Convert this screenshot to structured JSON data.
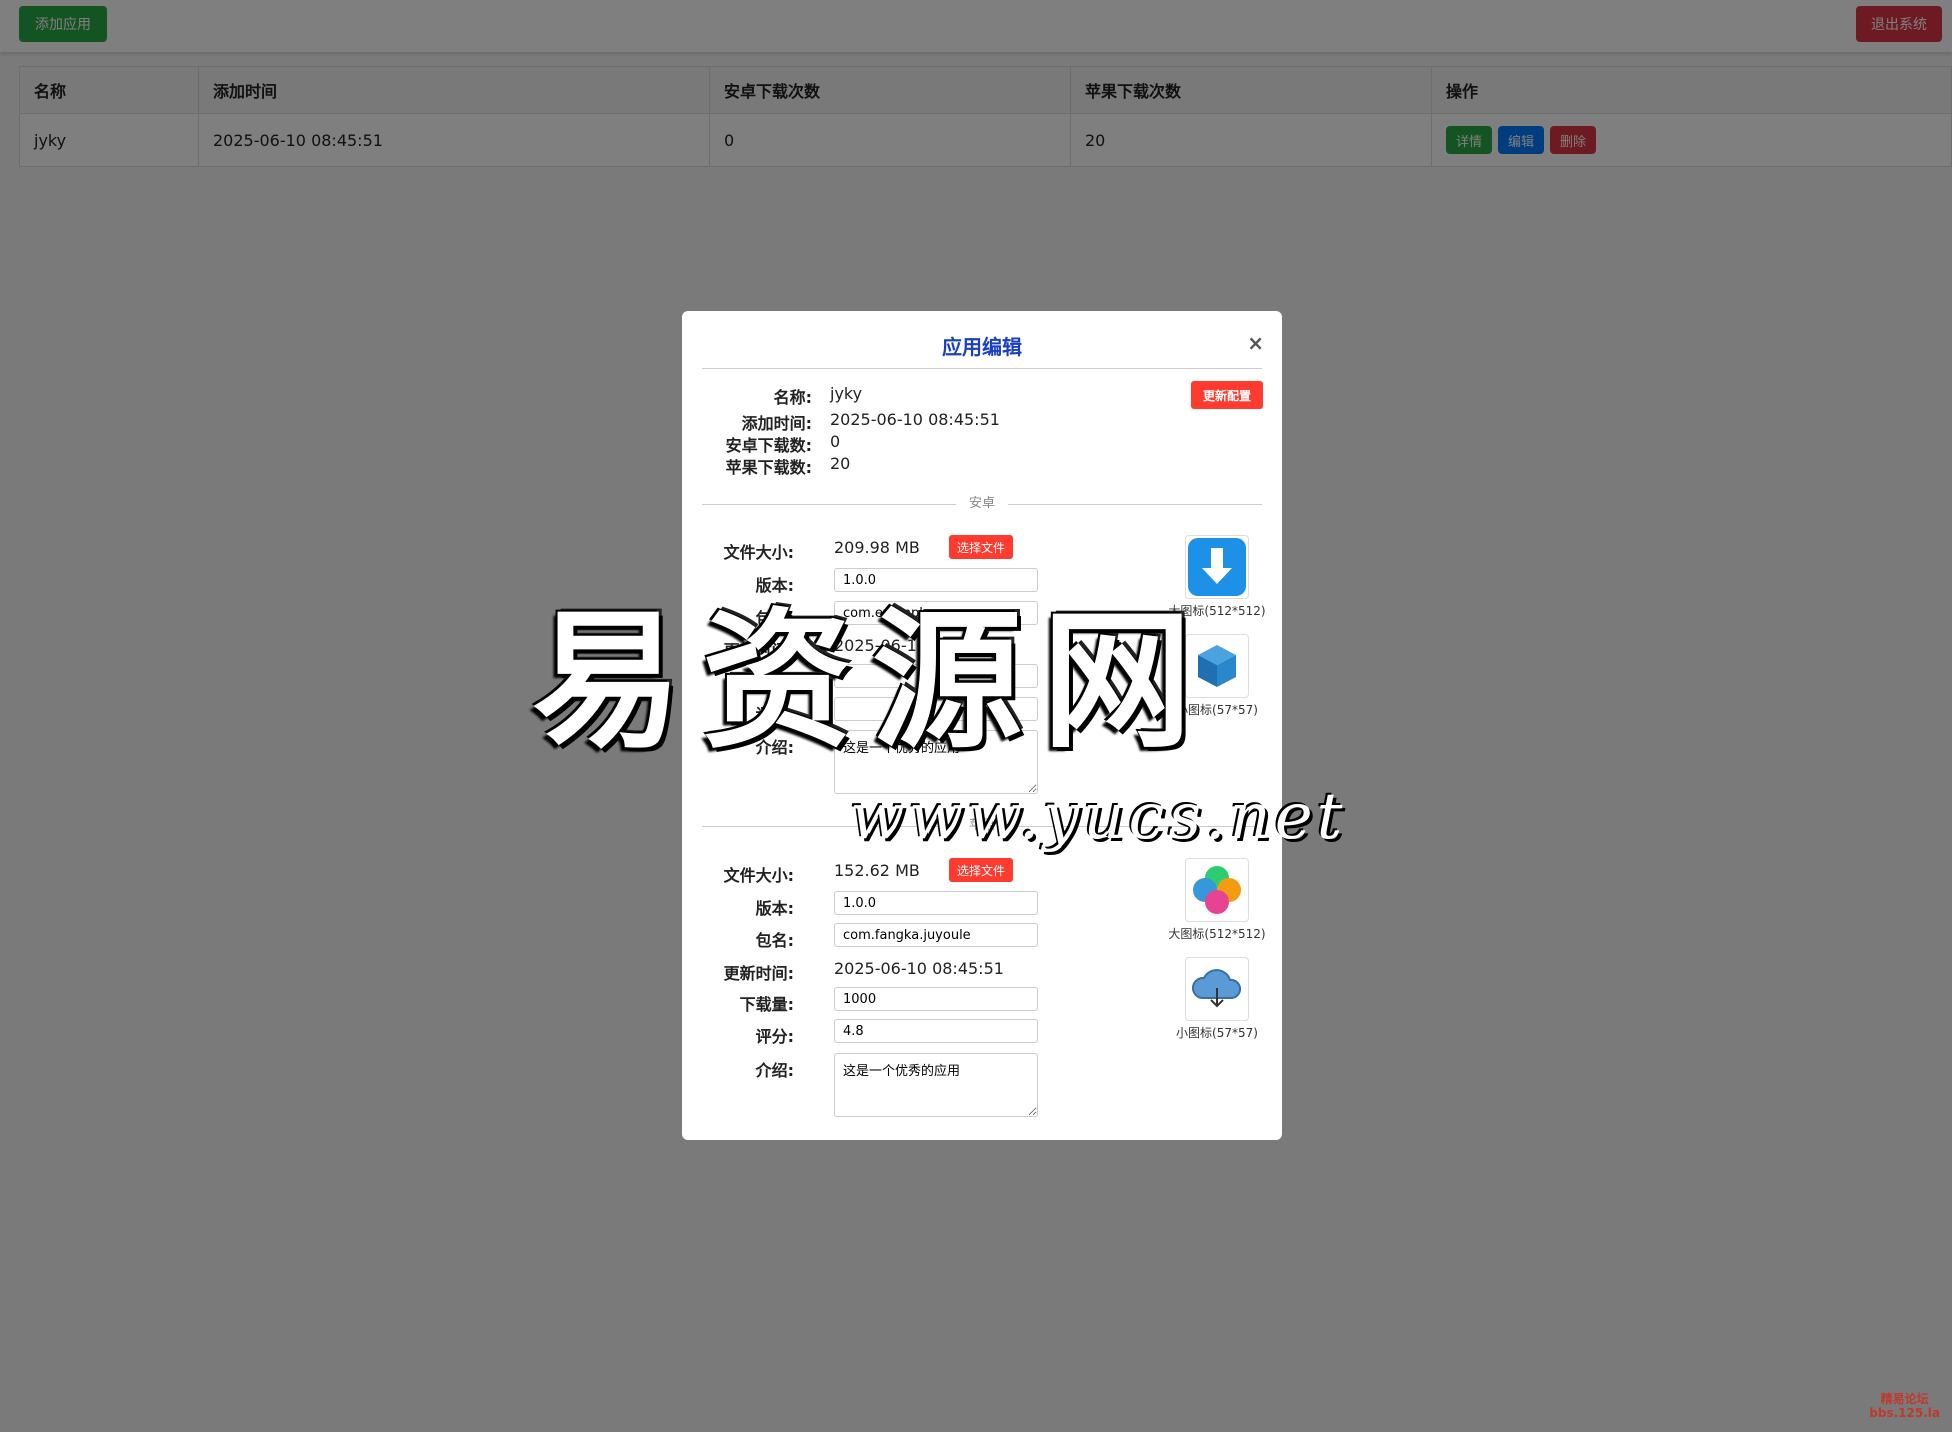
{
  "topbar": {
    "add_label": "添加应用",
    "logout_label": "退出系统"
  },
  "table": {
    "headers": [
      "名称",
      "添加时间",
      "安卓下载次数",
      "苹果下载次数",
      "操作"
    ],
    "rows": [
      {
        "name": "jyky",
        "added": "2025-06-10 08:45:51",
        "android": "0",
        "ios": "20",
        "actions": [
          "详情",
          "编辑",
          "删除"
        ]
      }
    ]
  },
  "modal": {
    "title": "应用编辑",
    "close": "×",
    "update_label": "更新配置",
    "info": [
      {
        "k": "名称:",
        "v": "jyky"
      },
      {
        "k": "添加时间:",
        "v": "2025-06-10 08:45:51"
      },
      {
        "k": "安卓下载数:",
        "v": "0"
      },
      {
        "k": "苹果下载数:",
        "v": "20"
      }
    ],
    "android": {
      "section_label": "安卓",
      "size_label": "文件大小:",
      "size": "209.98 MB",
      "file_btn": "选择文件",
      "version_label": "版本:",
      "version": "1.0.0",
      "package_label": "包名:",
      "package": "com.example.app",
      "updated_label": "更新时间:",
      "updated": "2025-06-10 08:45:51",
      "downloads_label": "下载量:",
      "downloads": "",
      "rating_label": "评分:",
      "rating": "",
      "intro_label": "介绍:",
      "intro": "这是一个优秀的应用",
      "big_icon_caption": "大图标(512*512)",
      "small_icon_caption": "小图标(57*57)"
    },
    "ios": {
      "section_label": "苹果",
      "size_label": "文件大小:",
      "size": "152.62 MB",
      "file_btn": "选择文件",
      "version_label": "版本:",
      "version": "1.0.0",
      "package_label": "包名:",
      "package": "com.fangka.juyoule",
      "updated_label": "更新时间:",
      "updated": "2025-06-10 08:45:51",
      "downloads_label": "下载量:",
      "downloads": "1000",
      "rating_label": "评分:",
      "rating": "4.8",
      "intro_label": "介绍:",
      "intro": "这是一个优秀的应用",
      "big_icon_caption": "大图标(512*512)",
      "small_icon_caption": "小图标(57*57)"
    }
  },
  "watermark": {
    "text": "易资源网",
    "url": "www.yucs.net"
  },
  "corner_logo": {
    "line1": "精易论坛",
    "line2": "bbs.125.la"
  },
  "colors": {
    "accent": "#1a3fc0",
    "success": "#28a745",
    "danger": "#dc3545",
    "primary": "#007bff"
  }
}
